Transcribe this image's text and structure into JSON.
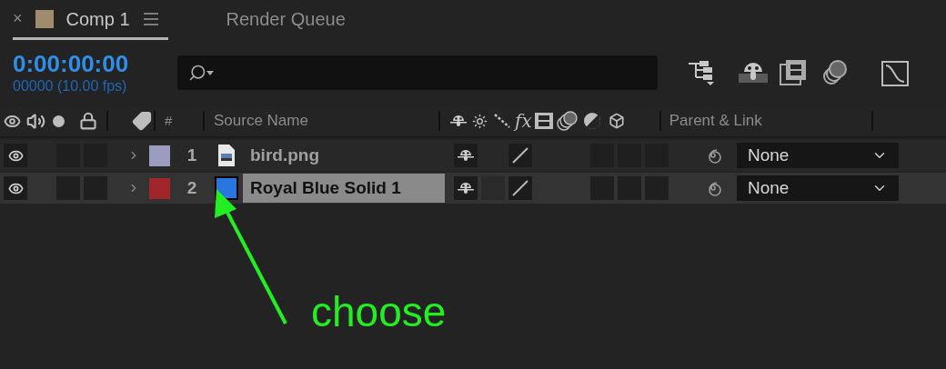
{
  "tabs": [
    {
      "label": "Comp 1",
      "selected": true,
      "color": "#a08c6c",
      "close": "×"
    },
    {
      "label": "Render Queue",
      "selected": false
    }
  ],
  "timecode": "0:00:00:00",
  "frame_info": "00000 (10.00 fps)",
  "columns": {
    "effects": "fx",
    "number": "#",
    "source_name": "Source Name",
    "parent_link": "Parent & Link"
  },
  "layers": [
    {
      "number": "1",
      "name": "bird.png",
      "kind": "image",
      "color": "#9c9cc0",
      "selected": false,
      "parent": "None"
    },
    {
      "number": "2",
      "name": "Royal Blue Solid 1",
      "kind": "solid",
      "color": "#a0262a",
      "swatch": {
        "color": "#2a76e0"
      },
      "selected": true,
      "parent": "None"
    }
  ],
  "annotation": {
    "text": "choose"
  }
}
